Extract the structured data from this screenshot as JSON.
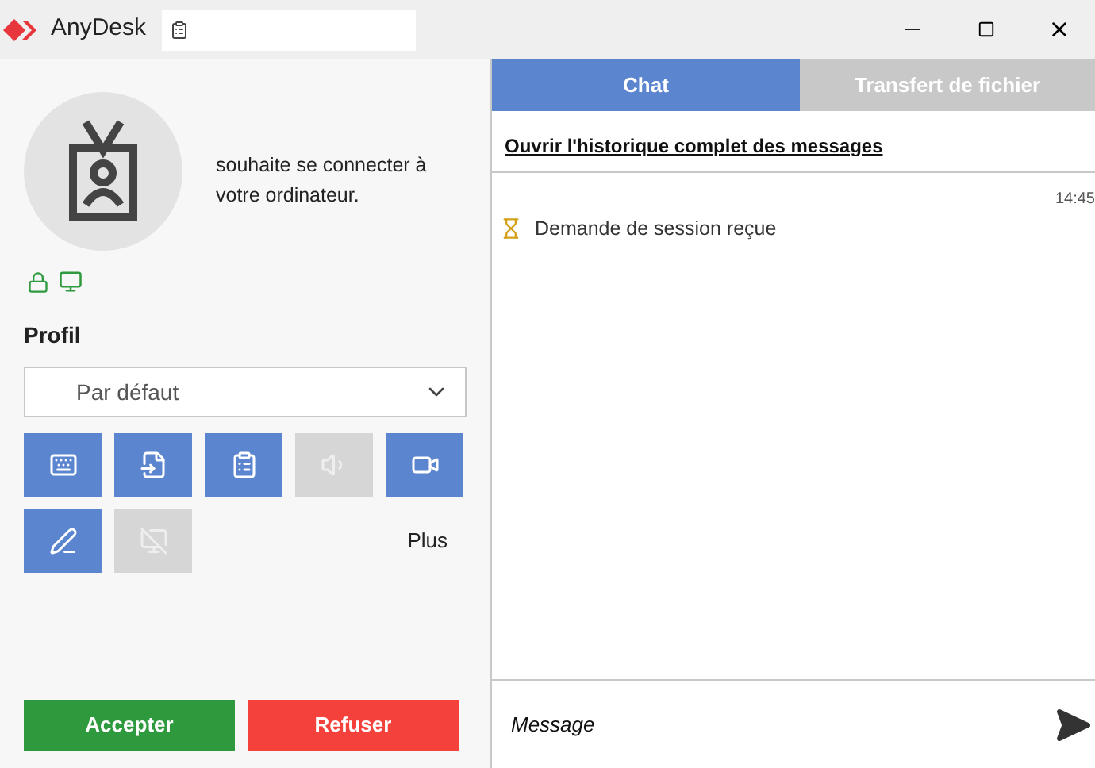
{
  "window": {
    "title": "AnyDesk"
  },
  "request": {
    "message": "souhaite se connecter à votre ordinateur."
  },
  "profile": {
    "label": "Profil",
    "value": "Par défaut"
  },
  "permissions": [
    {
      "kind": "input",
      "enabled": true
    },
    {
      "kind": "file",
      "enabled": true
    },
    {
      "kind": "clipboard",
      "enabled": true
    },
    {
      "kind": "sound",
      "enabled": false
    },
    {
      "kind": "record",
      "enabled": true
    },
    {
      "kind": "draw",
      "enabled": true
    },
    {
      "kind": "privacy",
      "enabled": false
    }
  ],
  "more": "Plus",
  "actions": {
    "accept": "Accepter",
    "refuse": "Refuser"
  },
  "tabs": [
    {
      "label": "Chat",
      "selected": true
    },
    {
      "label": "Transfert de fichier",
      "selected": false
    }
  ],
  "chat": {
    "history_link": "Ouvrir l'historique complet des messages",
    "messages": [
      {
        "time": "14:45",
        "text": "Demande de session reçue"
      }
    ],
    "placeholder": "Message"
  }
}
